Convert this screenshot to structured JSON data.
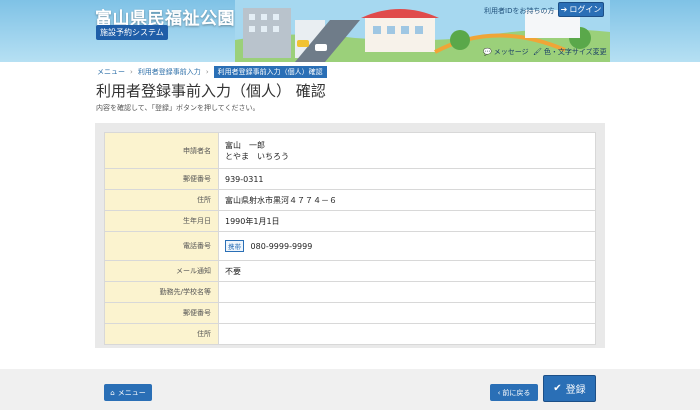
{
  "header": {
    "site_title": "富山県民福祉公園",
    "system_badge": "施設予約システム",
    "forgot_id_link": "利用者IDをお持ちの方",
    "login_label": "ログイン",
    "message_label": "メッセージ",
    "color_font_label": "色・文字サイズ変更"
  },
  "breadcrumb": {
    "items": [
      "メニュー",
      "利用者登録事前入力",
      "利用者登録事前入力（個人）確認"
    ]
  },
  "page": {
    "title": "利用者登録事前入力（個人） 確認",
    "instruction": "内容を確認して、「登録」ボタンを押してください。"
  },
  "form": {
    "rows": [
      {
        "label": "申請者名",
        "value_line1": "富山　一郎",
        "value_line2": "とやま　いちろう"
      },
      {
        "label": "郵便番号",
        "value": "939-0311"
      },
      {
        "label": "住所",
        "value": "富山県射水市黒河４７７４－６"
      },
      {
        "label": "生年月日",
        "value": "1990年1月1日"
      },
      {
        "label": "電話番号",
        "tag": "携帯",
        "value": "080-9999-9999"
      },
      {
        "label": "メール通知",
        "value": "不要"
      },
      {
        "label": "勤務先/学校名等",
        "value": ""
      },
      {
        "label": "郵便番号",
        "value": ""
      },
      {
        "label": "住所",
        "value": ""
      }
    ]
  },
  "footer": {
    "menu_label": "メニュー",
    "back_label": "前に戻る",
    "register_label": "登録"
  }
}
